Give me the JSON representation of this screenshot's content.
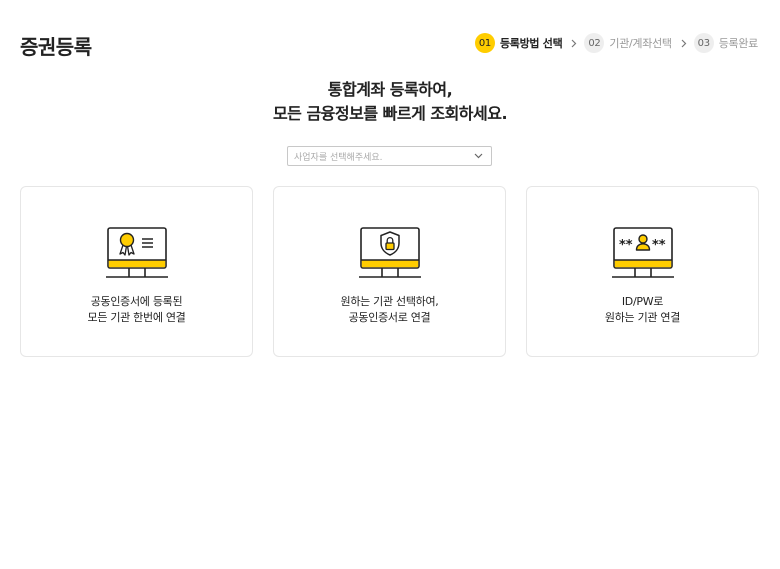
{
  "page": {
    "title": "증권등록"
  },
  "steps": [
    {
      "num": "01",
      "label": "등록방법 선택",
      "active": true
    },
    {
      "num": "02",
      "label": "기관/계좌선택",
      "active": false
    },
    {
      "num": "03",
      "label": "등록완료",
      "active": false
    }
  ],
  "headline": {
    "line1": "통합계좌 등록하여,",
    "line2": "모든 금융정보를 빠르게 조회하세요."
  },
  "select": {
    "placeholder": "사업자를 선택해주세요."
  },
  "cards": [
    {
      "icon": "certificate-monitor-icon",
      "line1": "공동인증서에 등록된",
      "line2": "모든 기관 한번에 연결"
    },
    {
      "icon": "shield-lock-monitor-icon",
      "line1": "원하는 기관 선택하여,",
      "line2": "공동인증서로 연결"
    },
    {
      "icon": "id-password-monitor-icon",
      "line1": "ID/PW로",
      "line2": "원하는 기관 연결"
    }
  ],
  "colors": {
    "accent": "#ffcd00",
    "text": "#222222",
    "muted": "#999999",
    "border": "#e6e6e6"
  }
}
